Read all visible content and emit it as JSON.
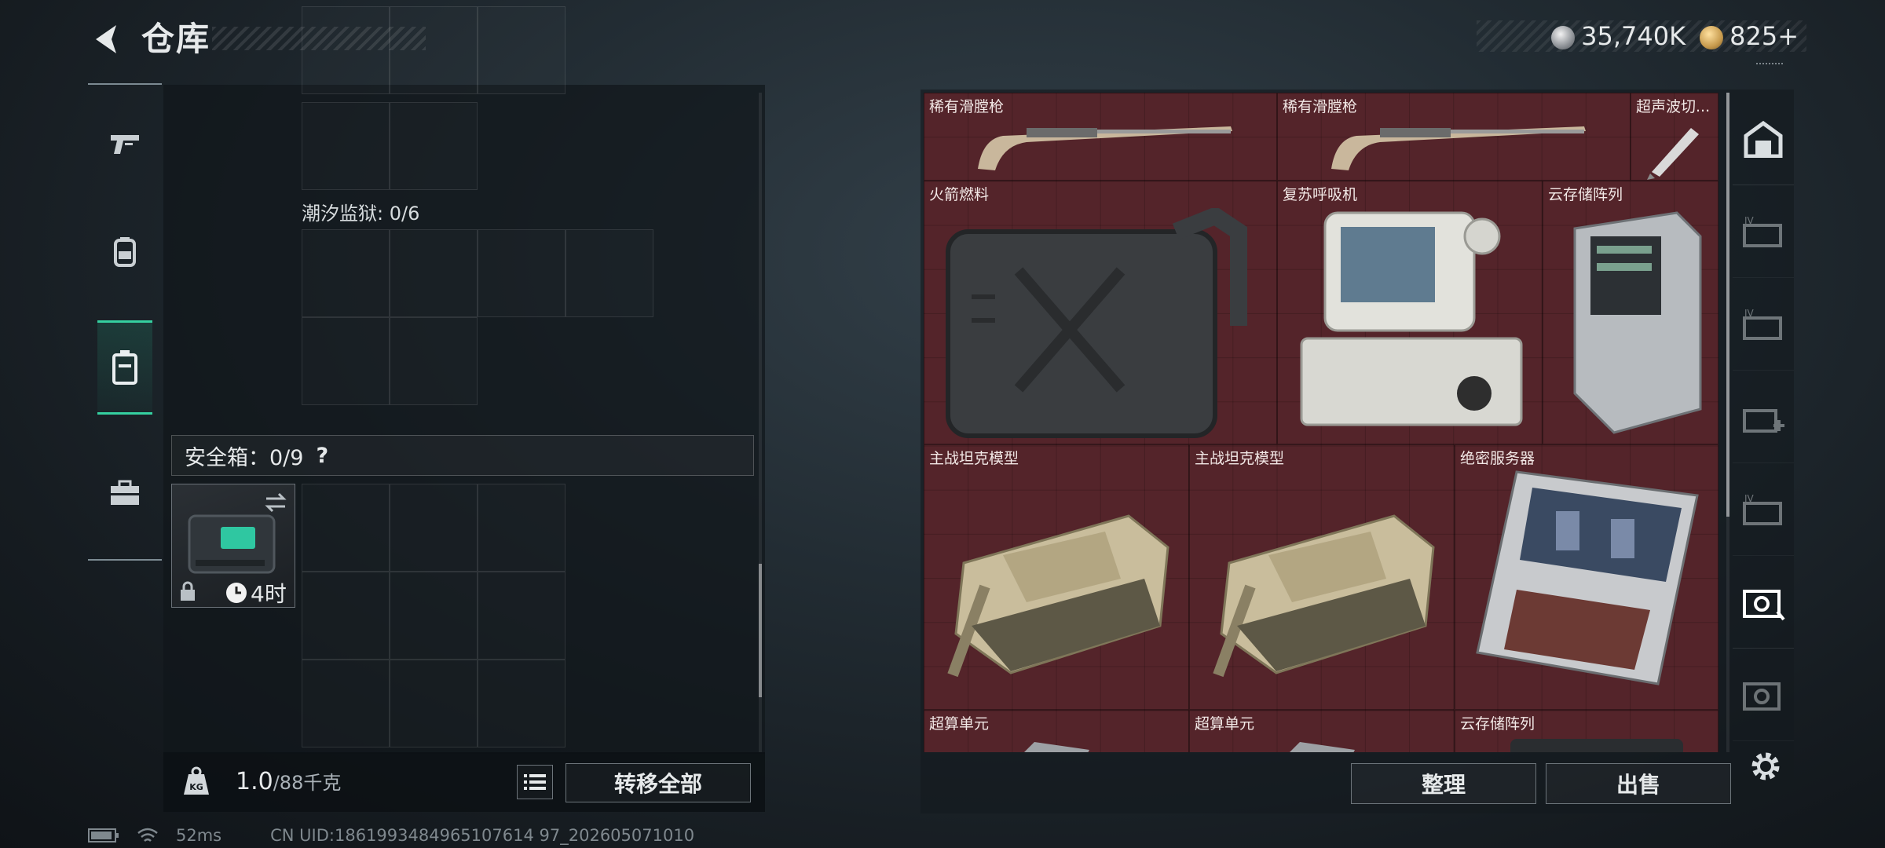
{
  "header": {
    "title": "仓库",
    "currency_silver": "35,740K",
    "currency_gold": "825",
    "gold_add_symbol": "+"
  },
  "left_tabs": [
    "pistol-tab",
    "backpack-tab",
    "storage-tab",
    "briefcase-tab"
  ],
  "left_panel": {
    "prison_label": "潮汐监狱: 0/6",
    "safebox_label": "安全箱：0/9",
    "safebox_help": "?",
    "safebox_timer": "4时",
    "weight_value": "1.0",
    "weight_capacity": "/88千克",
    "transfer_all": "转移全部"
  },
  "stash": {
    "items": [
      {
        "name": "稀有滑膛枪",
        "bg": "#5a2229"
      },
      {
        "name": "稀有滑膛枪",
        "bg": "#5a2229"
      },
      {
        "name": "超声波切...",
        "bg": "#5a2229"
      },
      {
        "name": "火箭燃料",
        "bg": "#5a2229"
      },
      {
        "name": "复苏呼吸机",
        "bg": "#5a2229"
      },
      {
        "name": "云存储阵列",
        "bg": "#5a2229"
      },
      {
        "name": "主战坦克模型",
        "bg": "#5a2229"
      },
      {
        "name": "主战坦克模型",
        "bg": "#5a2229"
      },
      {
        "name": "绝密服务器",
        "bg": "#5a2229"
      },
      {
        "name": "超算单元",
        "bg": "#5a2229"
      },
      {
        "name": "超算单元",
        "bg": "#5a2229"
      },
      {
        "name": "云存储阵列",
        "bg": "#5a2229"
      }
    ],
    "sort_label": "整理",
    "sell_label": "出售"
  },
  "status": {
    "ping": "52ms",
    "uid": "CN UID:1861993484965107614 97_202605071010"
  }
}
